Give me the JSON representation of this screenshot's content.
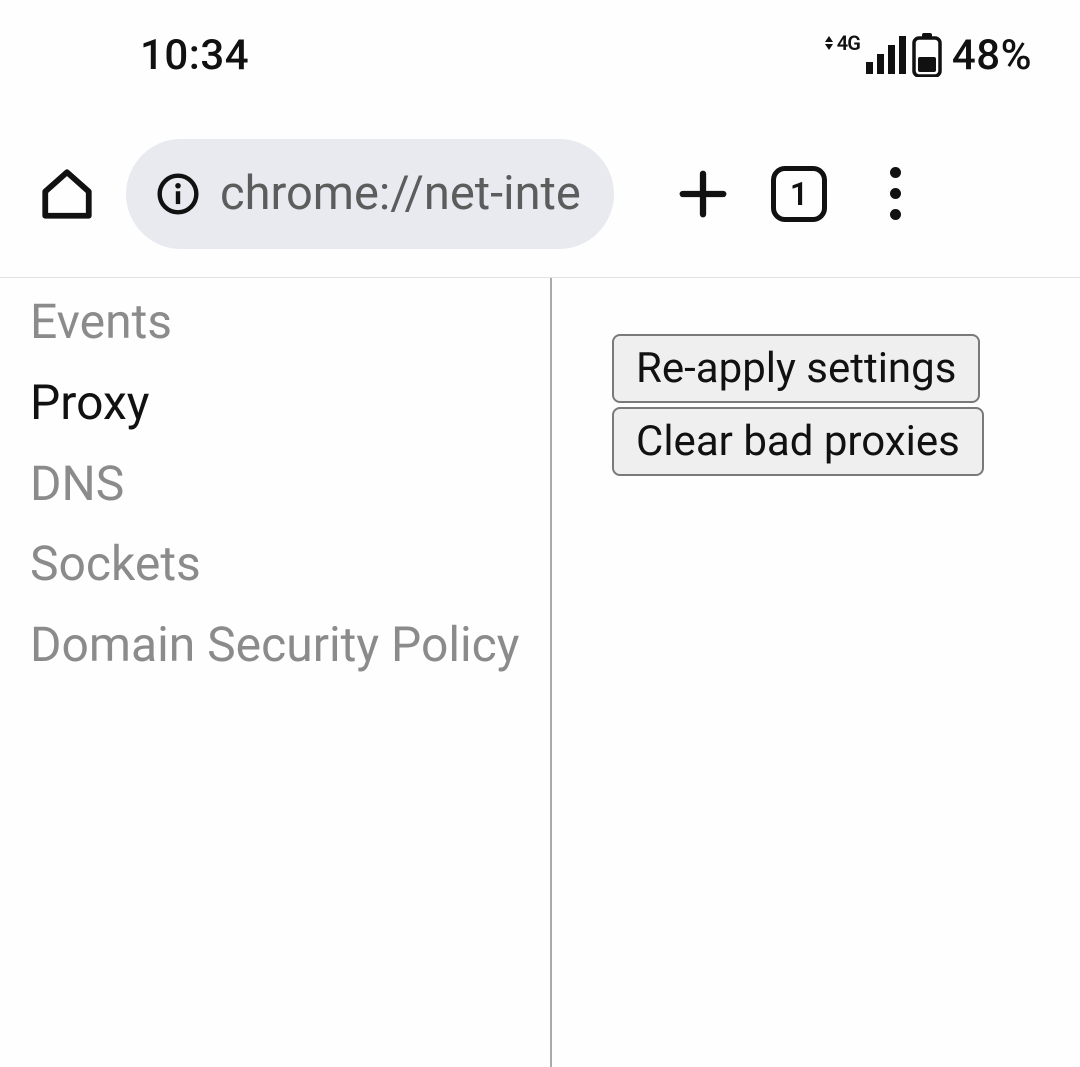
{
  "status_bar": {
    "time": "10:34",
    "network_label": "4G",
    "battery_pct": "48%"
  },
  "browser_chrome": {
    "url": "chrome://net-inte",
    "tab_count": "1"
  },
  "sidebar": {
    "items": [
      {
        "label": "Events",
        "active": false
      },
      {
        "label": "Proxy",
        "active": true
      },
      {
        "label": "DNS",
        "active": false
      },
      {
        "label": "Sockets",
        "active": false
      },
      {
        "label": "Domain Security Policy",
        "active": false
      }
    ]
  },
  "main": {
    "buttons": {
      "reapply": "Re-apply settings",
      "clear": "Clear bad proxies"
    }
  }
}
